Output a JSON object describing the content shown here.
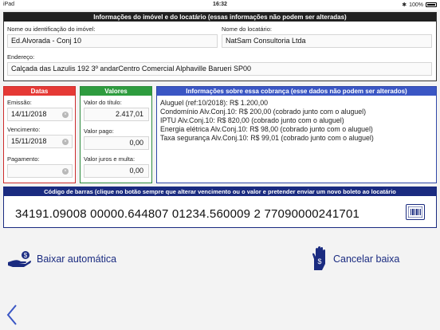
{
  "status_bar": {
    "device": "iPad",
    "time": "16:32",
    "battery": "100%"
  },
  "imovel": {
    "title": "Informações do imóvel e do locatário (essas informações não podem ser alteradas)",
    "nome_label": "Nome ou identificação do imóvel:",
    "nome_value": "Ed.Alvorada - Conj 10",
    "locatario_label": "Nome do locatário:",
    "locatario_value": "NatSam Consultoria Ltda",
    "endereco_label": "Endereço:",
    "endereco_value": "Calçada das Lazulis 192 3º andarCentro Comercial Alphaville Barueri SP00"
  },
  "datas": {
    "title": "Datas",
    "emissao_label": "Emissão:",
    "emissao_value": "14/11/2018",
    "vencimento_label": "Vencimento:",
    "vencimento_value": "15/11/2018",
    "pagamento_label": "Pagamento:",
    "pagamento_value": ""
  },
  "valores": {
    "title": "Valores",
    "titulo_label": "Valor do título:",
    "titulo_value": "2.417,01",
    "pago_label": "Valor pago:",
    "pago_value": "0,00",
    "juros_label": "Valor juros e multa:",
    "juros_value": "0,00"
  },
  "cobranca": {
    "title": "Informações sobre essa cobrança (esse dados não podem ser alterados)",
    "lines": [
      "Aluguel (ref:10/2018): R$ 1.200,00",
      "Condomínio Alv.Conj.10: R$ 200,00 (cobrado junto com o aluguel)",
      "IPTU Alv.Conj.10: R$ 820,00 (cobrado junto com o aluguel)",
      "Energia elétrica Alv.Conj.10: R$ 98,00 (cobrado junto com o aluguel)",
      "Taxa segurança Alv.Conj.10: R$ 99,01 (cobrado junto com o aluguel)"
    ]
  },
  "barras": {
    "title": "Código de barras (clique no botão sempre que alterar vencimento ou o valor e pretender enviar um novo boleto ao locatário",
    "code": "34191.09008 00000.644807 01234.560009 2 77090000241701"
  },
  "actions": {
    "baixar_label": "Baixar automática",
    "cancelar_label": "Cancelar baixa"
  },
  "colors": {
    "datas": "#e53935",
    "valores": "#2e9c3f",
    "cobranca": "#3a56c4",
    "barras": "#1a2b80",
    "imovel": "#1f1f1f"
  },
  "icons": [
    "wifi-icon",
    "bluetooth-icon",
    "battery-icon",
    "clear-icon",
    "barcode-icon",
    "hand-money-icon",
    "hand-dollar-icon",
    "back-chevron-icon"
  ]
}
